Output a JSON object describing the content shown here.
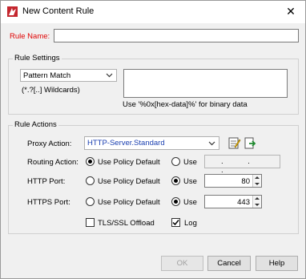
{
  "window": {
    "title": "New Content Rule",
    "close_glyph": "✕"
  },
  "rule_name": {
    "label": "Rule Name:",
    "value": "",
    "label_color": "#e00000"
  },
  "rule_settings": {
    "title": "Rule Settings",
    "match_type": "Pattern Match",
    "wildcard_hint": "(*.?[..] Wildcards)",
    "pattern_value": "",
    "binary_hint": "Use '%0x[hex-data]%' for binary data"
  },
  "rule_actions": {
    "title": "Rule Actions",
    "proxy_action_label": "Proxy Action:",
    "proxy_action_value": "HTTP-Server.Standard",
    "proxy_action_color": "#1a3fb0",
    "routing_action_label": "Routing Action:",
    "http_port_label": "HTTP Port:",
    "https_port_label": "HTTPS Port:",
    "use_policy_default": "Use Policy Default",
    "use": "Use",
    "routing_ip": ". . .",
    "http_port_value": "80",
    "https_port_value": "443",
    "tls_offload_label": "TLS/SSL Offload",
    "log_label": "Log",
    "routing_selected": "policy-default",
    "http_selected": "use",
    "https_selected": "use",
    "tls_offload_checked": false,
    "log_checked": true
  },
  "buttons": {
    "ok": "OK",
    "cancel": "Cancel",
    "help": "Help",
    "ok_enabled": false
  },
  "icons": [
    "app-icon",
    "close-icon",
    "chevron-down-icon",
    "edit-icon",
    "clone-icon"
  ]
}
